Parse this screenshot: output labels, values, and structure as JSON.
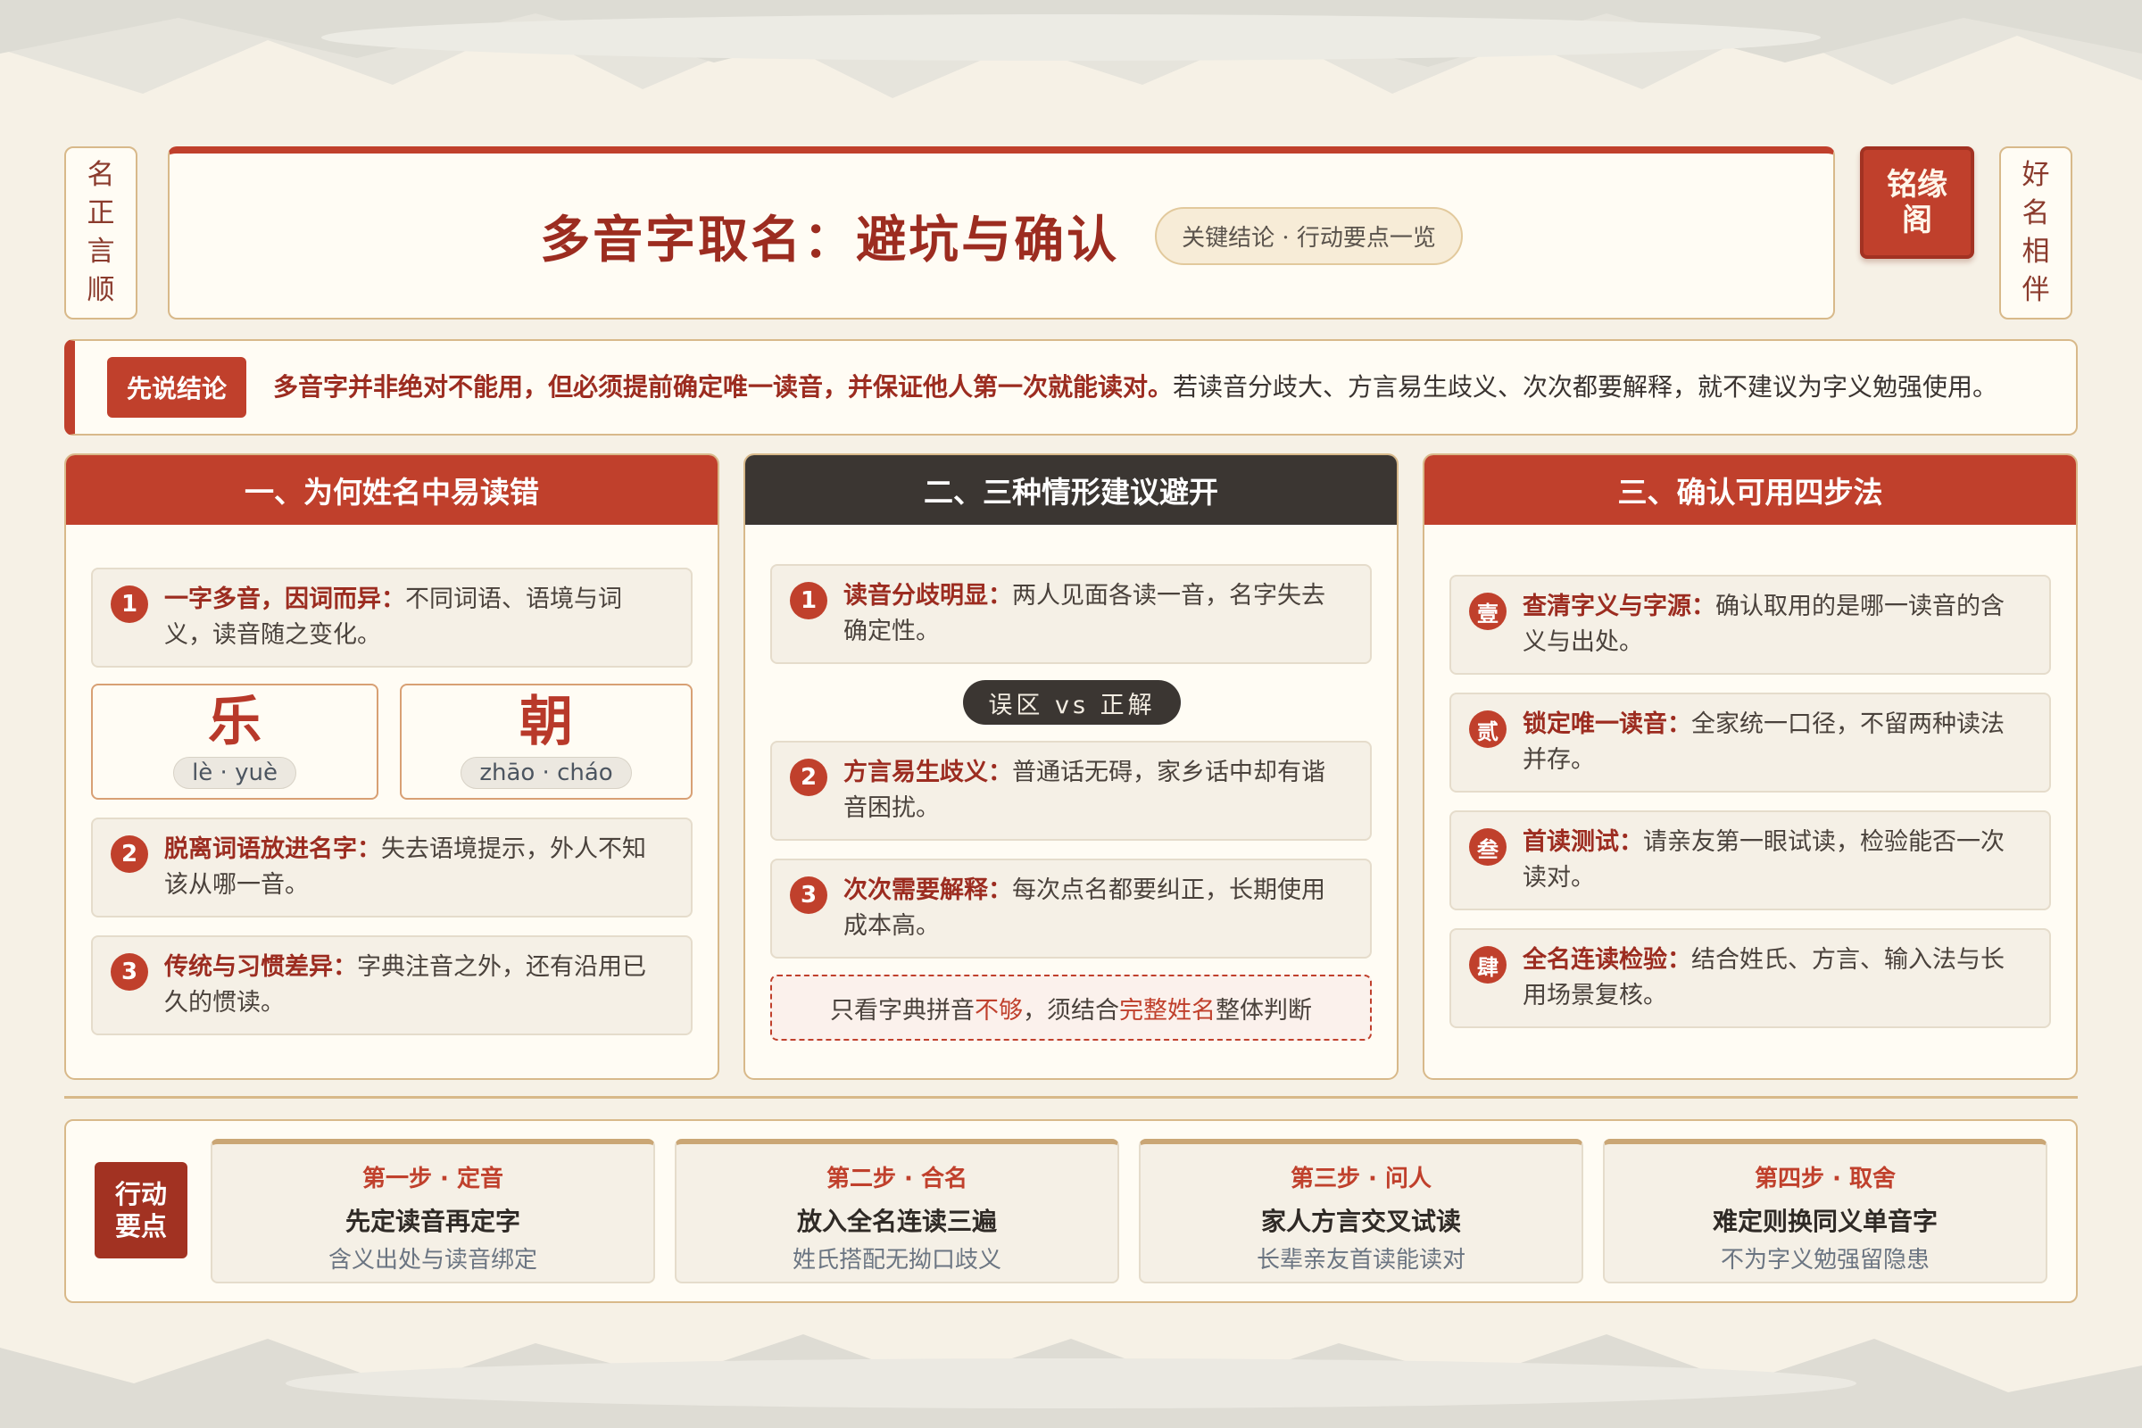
{
  "side_left": [
    "名",
    "正",
    "言",
    "顺"
  ],
  "side_right": [
    "好",
    "名",
    "相",
    "伴"
  ],
  "header": {
    "title": "多音字取名：避坑与确认",
    "tag": "关键结论 · 行动要点一览"
  },
  "seal": [
    "铭缘",
    "阁"
  ],
  "conclusion": {
    "label": "先说结论",
    "strong": "多音字并非绝对不能用，但必须提前确定唯一读音，并保证他人第一次就能读对。",
    "rest": "若读音分歧大、方言易生歧义、次次都要解释，就不建议为字义勉强使用。"
  },
  "col1": {
    "title": "一、为何姓名中易读错",
    "items": [
      {
        "num": "1",
        "title": "一字多音，因词而异：",
        "text": "不同词语、语境与词义，读音随之变化。"
      },
      {
        "num": "2",
        "title": "脱离词语放进名字：",
        "text": "失去语境提示，外人不知该从哪一音。"
      },
      {
        "num": "3",
        "title": "传统与习惯差异：",
        "text": "字典注音之外，还有沿用已久的惯读。"
      }
    ],
    "examples": [
      {
        "char": "乐",
        "pinyin": "lè · yuè"
      },
      {
        "char": "朝",
        "pinyin": "zhāo · cháo"
      }
    ]
  },
  "col2": {
    "title": "二、三种情形建议避开",
    "items": [
      {
        "num": "1",
        "title": "读音分歧明显：",
        "text": "两人见面各读一音，名字失去确定性。"
      },
      {
        "num": "2",
        "title": "方言易生歧义：",
        "text": "普通话无碍，家乡话中却有谐音困扰。"
      },
      {
        "num": "3",
        "title": "次次需要解释：",
        "text": "每次点名都要纠正，长期使用成本高。"
      }
    ],
    "vs_label": "误区 vs 正解",
    "note": {
      "p1": "只看字典拼音",
      "h1": "不够",
      "p2": "，须结合",
      "h2": "完整姓名",
      "p3": "整体判断"
    }
  },
  "col3": {
    "title": "三、确认可用四步法",
    "items": [
      {
        "num": "壹",
        "title": "查清字义与字源：",
        "text": "确认取用的是哪一读音的含义与出处。"
      },
      {
        "num": "贰",
        "title": "锁定唯一读音：",
        "text": "全家统一口径，不留两种读法并存。"
      },
      {
        "num": "叁",
        "title": "首读测试：",
        "text": "请亲友第一眼试读，检验能否一次读对。"
      },
      {
        "num": "肆",
        "title": "全名连读检验：",
        "text": "结合姓氏、方言、输入法与长用场景复核。"
      }
    ]
  },
  "actions": {
    "label": [
      "行动",
      "要点"
    ],
    "steps": [
      {
        "title": "第一步 · 定音",
        "main": "先定读音再定字",
        "sub": "含义出处与读音绑定"
      },
      {
        "title": "第二步 · 合名",
        "main": "放入全名连读三遍",
        "sub": "姓氏搭配无拗口歧义"
      },
      {
        "title": "第三步 · 问人",
        "main": "家人方言交叉试读",
        "sub": "长辈亲友首读能读对"
      },
      {
        "title": "第四步 · 取舍",
        "main": "难定则换同义单音字",
        "sub": "不为字义勉强留隐患"
      }
    ]
  },
  "colors": {
    "accent": "#c0402c",
    "dark": "#3b3632",
    "paper": "#fffcf4",
    "border": "#d8b98a"
  }
}
